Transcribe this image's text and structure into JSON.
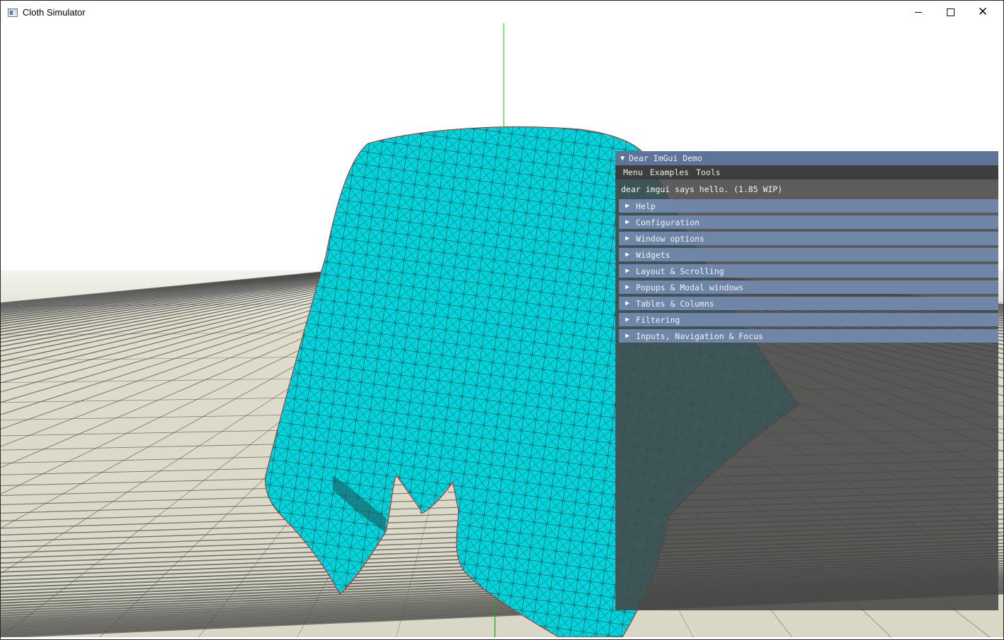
{
  "window": {
    "title": "Cloth Simulator",
    "min_glyph": "",
    "max_glyph": "",
    "close_glyph": "✕"
  },
  "scene": {
    "background": "#ffffff",
    "floor_color": "#d9d7c6",
    "grid_color": "#4a4a4a",
    "cloth_color": "#00d4dd",
    "cloth_wire_color": "#1a1a1a",
    "axis_color": "#00c000"
  },
  "imgui": {
    "title": "Dear ImGui Demo",
    "collapse_glyph": "▼",
    "menu": [
      "Menu",
      "Examples",
      "Tools"
    ],
    "hello": "dear imgui says hello. (1.85 WIP)",
    "headers": [
      "Help",
      "Configuration",
      "Window options",
      "Widgets",
      "Layout & Scrolling",
      "Popups & Modal windows",
      "Tables & Columns",
      "Filtering",
      "Inputs, Navigation & Focus"
    ],
    "header_glyph": "▶",
    "colors": {
      "title_bg": "#5d7498",
      "header_bg": "#6f86a8",
      "body_bg": "#464646"
    }
  }
}
